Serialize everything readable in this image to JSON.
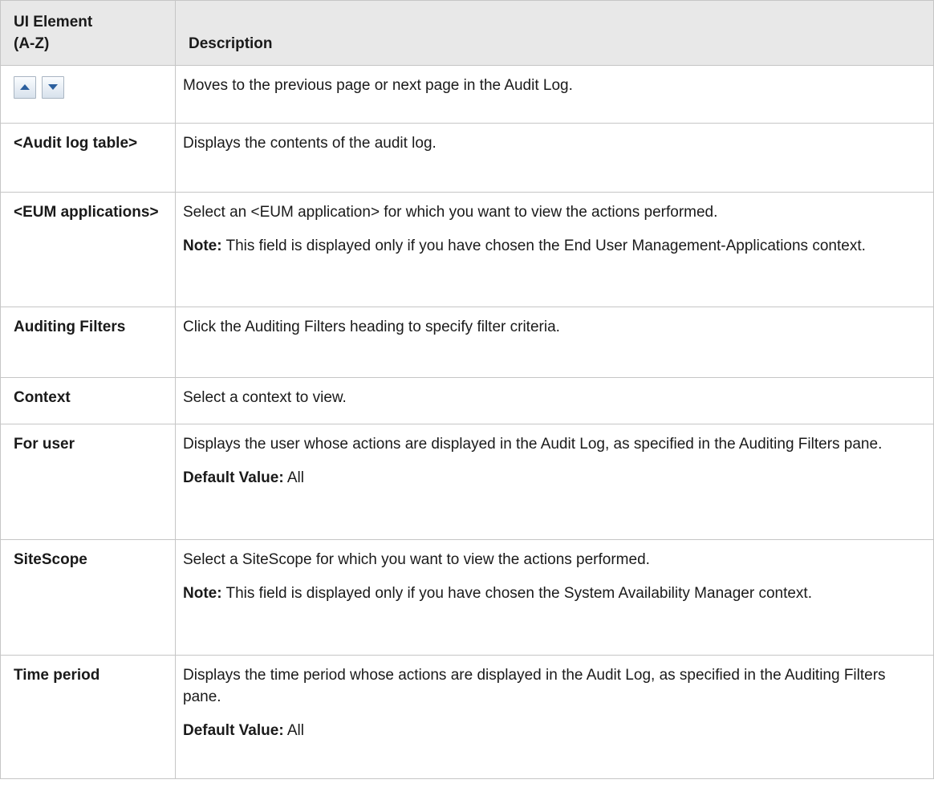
{
  "header": {
    "col1_line1": "UI Element",
    "col1_line2": "(A-Z)",
    "col2": "Description"
  },
  "rows": [
    {
      "element": "",
      "icons": [
        "up-arrow-icon",
        "down-arrow-icon"
      ],
      "description": "Moves to the previous page or next page in the Audit Log."
    },
    {
      "element": "<Audit log table>",
      "description": "Displays the contents of the audit log."
    },
    {
      "element": "<EUM applications>",
      "description": "Select an <EUM application> for which you want to view the actions performed.",
      "note_label": "Note:",
      "note_text": " This field is displayed only if you have chosen the End User Management-Applications context."
    },
    {
      "element": "Auditing Filters",
      "description": "Click the Auditing Filters heading to specify filter criteria."
    },
    {
      "element": "Context",
      "description": "Select a context to view."
    },
    {
      "element": "For user",
      "description": "Displays the user whose actions are displayed in the Audit Log, as specified in the Auditing Filters pane.",
      "default_label": "Default Value:",
      "default_value": " All"
    },
    {
      "element": "SiteScope",
      "description": "Select a SiteScope for which you want to view the actions performed.",
      "note_label": "Note:",
      "note_text": " This field is displayed only if you have chosen the System Availability Manager context."
    },
    {
      "element": "Time period",
      "description": "Displays the time period whose actions are displayed in the Audit Log, as specified in the Auditing Filters pane.",
      "default_label": "Default Value:",
      "default_value": " All"
    }
  ],
  "colors": {
    "header_bg": "#e8e8e8",
    "border": "#c6c6c6",
    "arrow": "#2b5f9e"
  }
}
